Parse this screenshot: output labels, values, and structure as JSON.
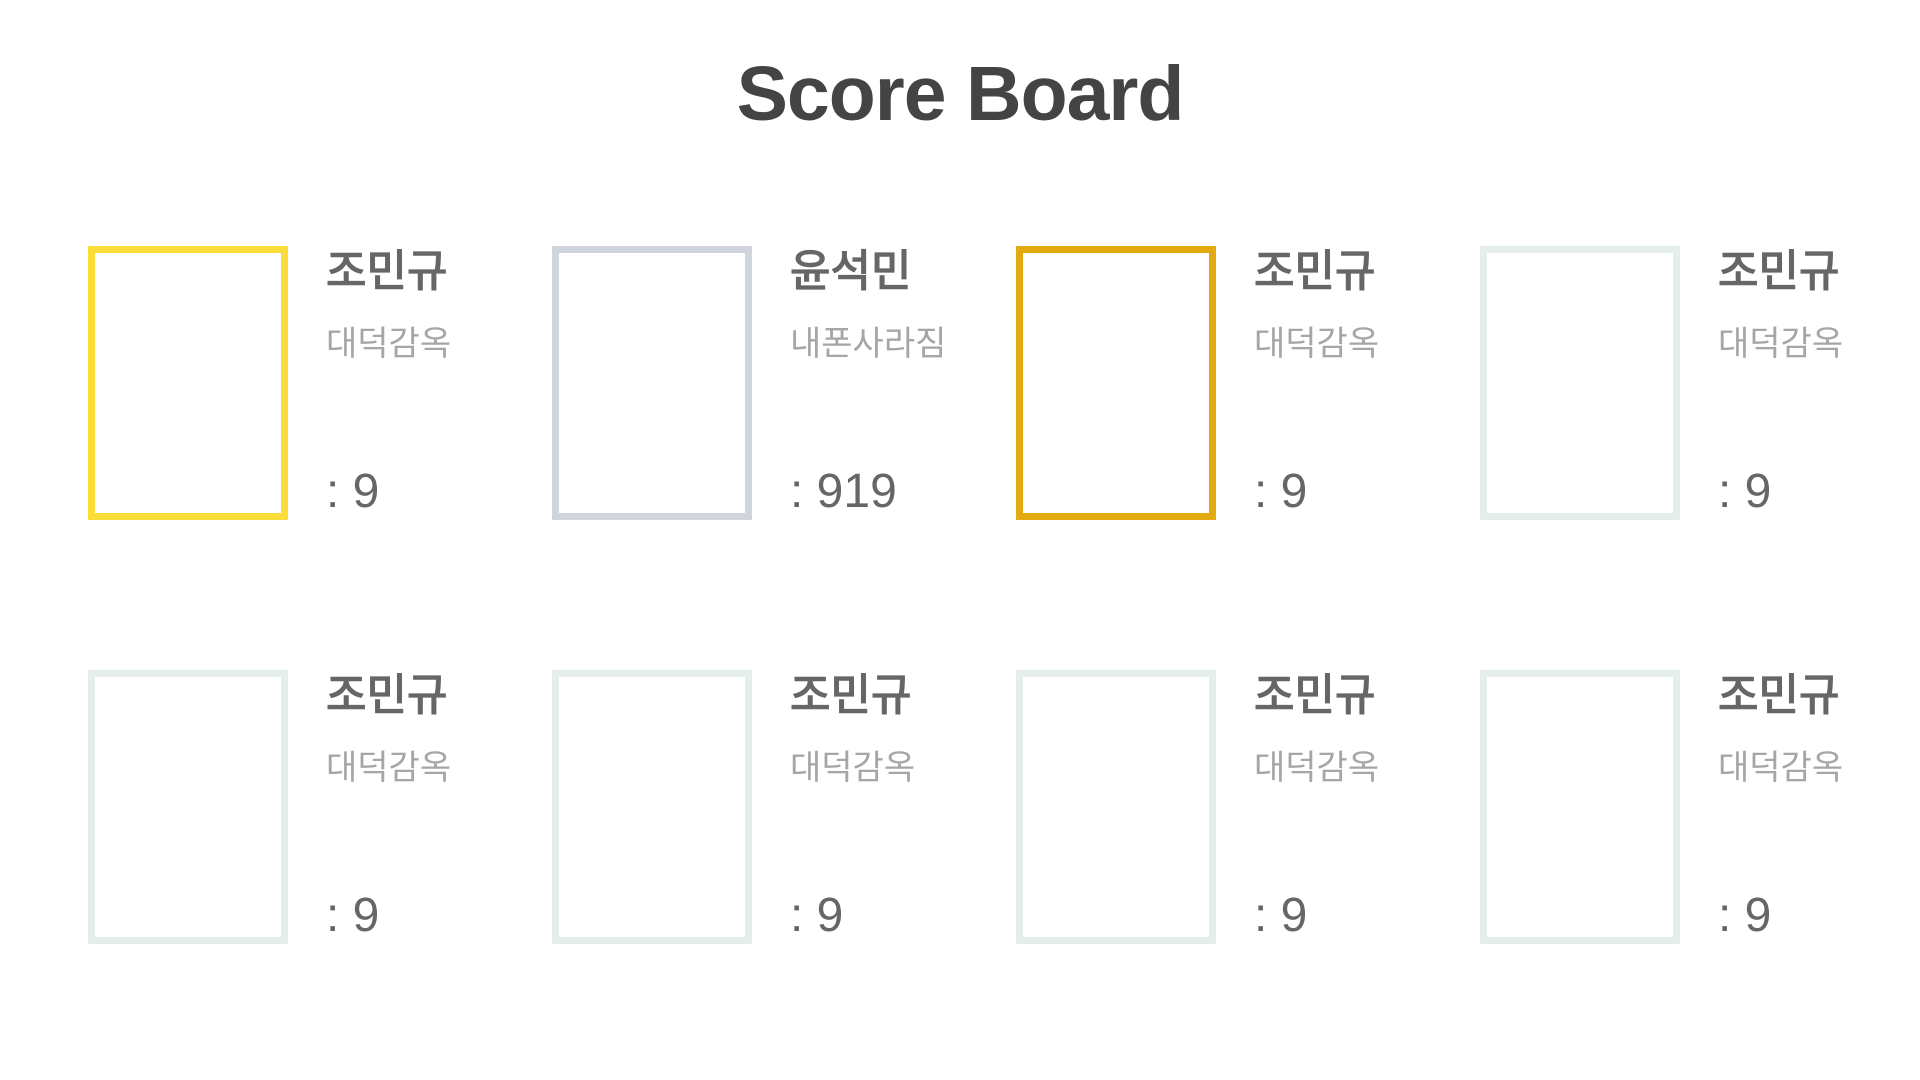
{
  "title": "Score Board",
  "players": [
    {
      "name": "조민규",
      "team": "대덕감옥",
      "score": ": 9",
      "frame_color": "#fbdd3a"
    },
    {
      "name": "윤석민",
      "team": "내폰사라짐",
      "score": ": 919",
      "frame_color": "#d0d4dc"
    },
    {
      "name": "조민규",
      "team": "대덕감옥",
      "score": ": 9",
      "frame_color": "#e2a911"
    },
    {
      "name": "조민규",
      "team": "대덕감옥",
      "score": ": 9",
      "frame_color": "#e6eeeb"
    },
    {
      "name": "조민규",
      "team": "대덕감옥",
      "score": ": 9",
      "frame_color": "#e6eeeb"
    },
    {
      "name": "조민규",
      "team": "대덕감옥",
      "score": ": 9",
      "frame_color": "#e6eeeb"
    },
    {
      "name": "조민규",
      "team": "대덕감옥",
      "score": ": 9",
      "frame_color": "#e6eeeb"
    },
    {
      "name": "조민규",
      "team": "대덕감옥",
      "score": ": 9",
      "frame_color": "#e6eeeb"
    }
  ]
}
